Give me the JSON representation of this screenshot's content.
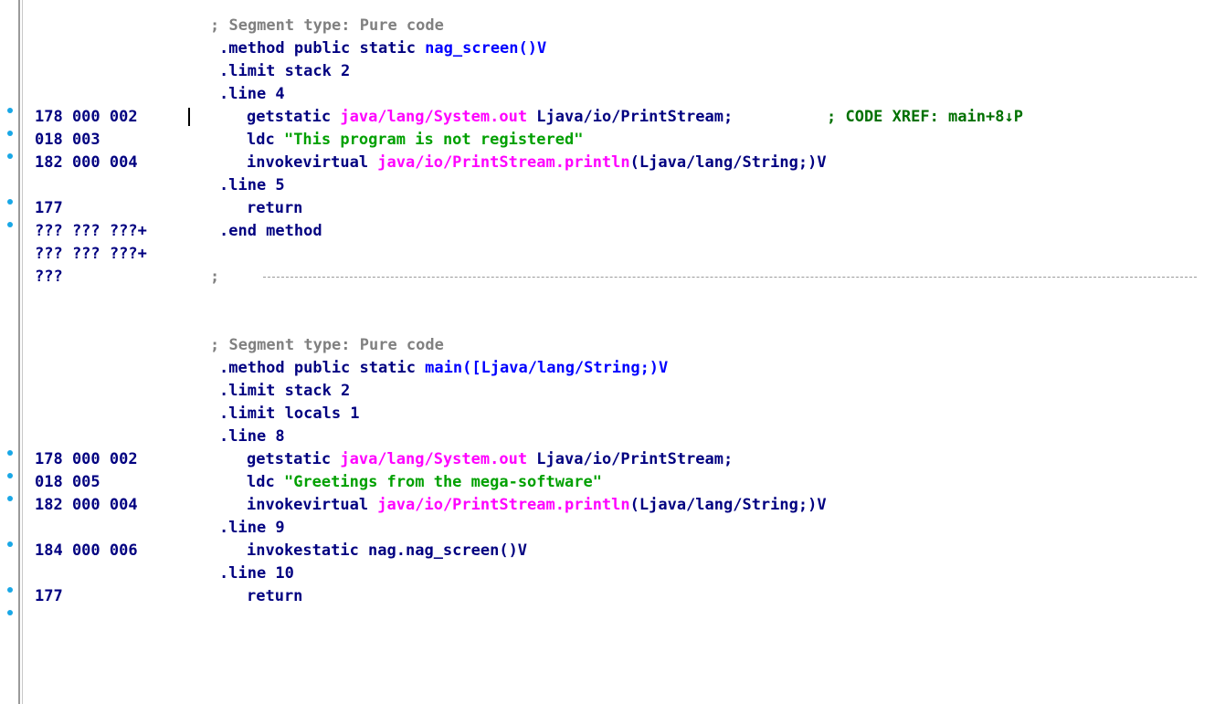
{
  "listing": {
    "segment1_comment": "; Segment type: Pure code",
    "method1_decl": ".method public static ",
    "method1_name": "nag_screen()V",
    "m1_limit_stack": ".limit stack 2",
    "m1_line4": ".line 4",
    "m1_r1_op": "178 000 002",
    "m1_r1_instr": "getstatic ",
    "m1_r1_ref": "java/lang/System.out",
    "m1_r1_type": " Ljava/io/PrintStream;",
    "m1_r1_xref": "; CODE XREF: main+8↓P",
    "m1_r2_op": "018 003",
    "m1_r2_instr": "ldc ",
    "m1_r2_str": "\"This program is not registered\"",
    "m1_r3_op": "182 000 004",
    "m1_r3_instr": "invokevirtual ",
    "m1_r3_ref": "java/io/PrintStream.println",
    "m1_r3_sig": "(Ljava/lang/String;)V",
    "m1_line5": ".line 5",
    "m1_r4_op": "177",
    "m1_r4_instr": "return",
    "m1_r5_op": "??? ??? ???+",
    "m1_end": ".end method",
    "m1_r6_op": "??? ??? ???+",
    "m1_r7_op": "???",
    "m1_r7_comment": ";",
    "segment2_comment": "; Segment type: Pure code",
    "method2_decl": ".method public static ",
    "method2_name": "main([Ljava/lang/String;)V",
    "m2_limit_stack": ".limit stack 2",
    "m2_limit_locals": ".limit locals 1",
    "m2_line8": ".line 8",
    "m2_r1_op": "178 000 002",
    "m2_r1_instr": "getstatic ",
    "m2_r1_ref": "java/lang/System.out",
    "m2_r1_type": " Ljava/io/PrintStream;",
    "m2_r2_op": "018 005",
    "m2_r2_instr": "ldc ",
    "m2_r2_str": "\"Greetings from the mega-software\"",
    "m2_r3_op": "182 000 004",
    "m2_r3_instr": "invokevirtual ",
    "m2_r3_ref": "java/io/PrintStream.println",
    "m2_r3_sig": "(Ljava/lang/String;)V",
    "m2_line9": ".line 9",
    "m2_r4_op": "184 000 006",
    "m2_r4_instr": "invokestatic nag.nag_screen()V",
    "m2_line10": ".line 10",
    "m2_r5_op": "177",
    "m2_r5_instr": "return"
  },
  "colors": {
    "opcode": "#000080",
    "comment": "#808080",
    "string": "#00a000",
    "reference": "#ff00ff",
    "xref": "#007000",
    "marker": "#19a7e6"
  }
}
